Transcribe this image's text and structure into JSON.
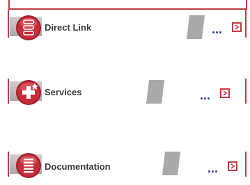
{
  "items": [
    {
      "label": "Direct Link",
      "more": "...",
      "icon": "list-circle-icon"
    },
    {
      "label": "Services",
      "more": "...",
      "icon": "plus-star-icon"
    },
    {
      "label": "Documentation",
      "more": "...",
      "icon": "document-lines-icon"
    }
  ],
  "colors": {
    "accent": "#c03a45",
    "link": "#1a3a9a",
    "label": "#3a3a3a",
    "tab_grey": "#bcbcbc"
  }
}
